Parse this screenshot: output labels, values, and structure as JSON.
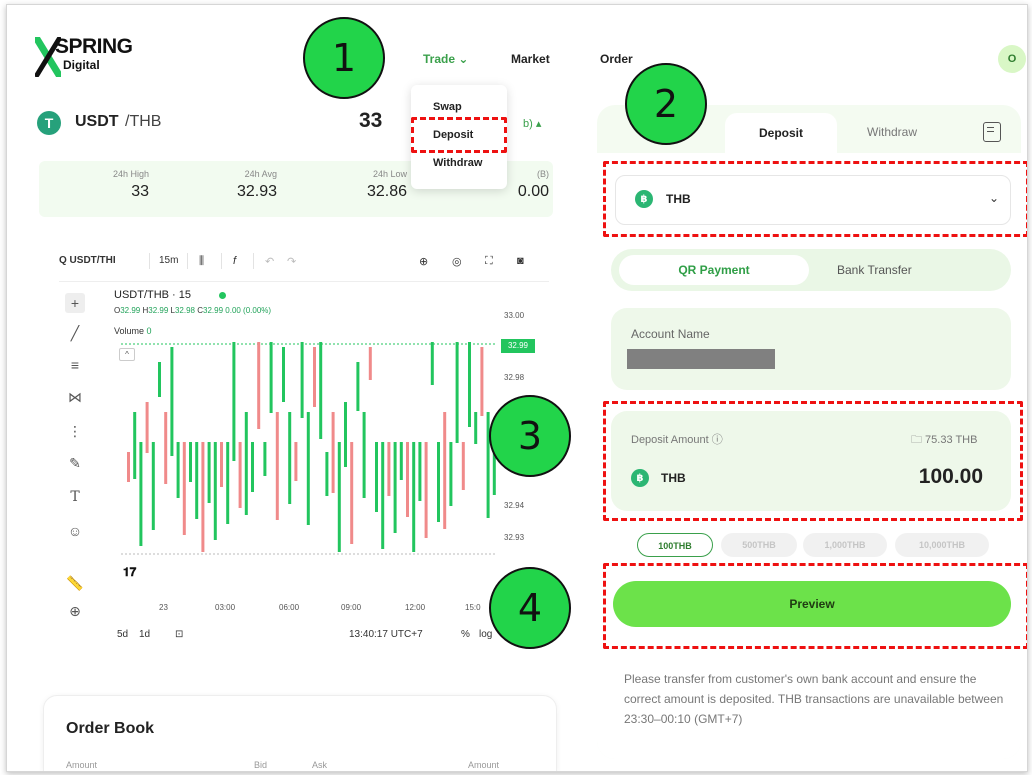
{
  "brand": {
    "name": "SPRING",
    "sub": "Digital"
  },
  "nav": {
    "trade": "Trade ⌄",
    "market": "Market",
    "order": "Order",
    "avatar": "O"
  },
  "trade_menu": {
    "swap": "Swap",
    "deposit": "Deposit",
    "withdraw": "Withdraw"
  },
  "pair": {
    "base": "USDT",
    "quote": "/THB",
    "price": "33",
    "price_tail": "b) ▴"
  },
  "stats": [
    {
      "label": "24h High",
      "value": "33"
    },
    {
      "label": "24h Avg",
      "value": "32.93"
    },
    {
      "label": "24h Low",
      "value": "32.86"
    },
    {
      "label": "(B)",
      "value": "0.00"
    }
  ],
  "chart_toolbar": {
    "symbol": "Q USDT/THI",
    "interval": "15m"
  },
  "chart_data": {
    "type": "candlestick",
    "title": "USDT/THB · 15",
    "ohlc_text": {
      "o": "32.99",
      "h": "32.99",
      "l": "32.98",
      "c": "32.99",
      "chg": "0.00 (0.00%)"
    },
    "volume_label": "Volume",
    "volume_value": "0",
    "y_ticks": [
      "33.00",
      "32.98",
      "32.94",
      "32.93"
    ],
    "last_price": "32.99",
    "x_ticks": [
      "23",
      "03:00",
      "06:00",
      "09:00",
      "12:00",
      "15:0"
    ],
    "ylim": [
      32.91,
      33.01
    ]
  },
  "chart_bottom": {
    "range_5d": "5d",
    "range_1d": "1d",
    "time": "13:40:17 UTC+7",
    "pct": "%",
    "log": "log"
  },
  "orderbook": {
    "title": "Order Book",
    "cols": [
      "Amount",
      "Bid",
      "Ask",
      "Amount"
    ]
  },
  "panel": {
    "tabs": {
      "deposit": "Deposit",
      "withdraw": "Withdraw"
    },
    "currency": "THB",
    "methods": {
      "qr": "QR Payment",
      "bank": "Bank Transfer"
    },
    "account_label": "Account Name",
    "amount_label": "Deposit Amount ⓘ",
    "balance": "🗀 75.33 THB",
    "amount_currency": "THB",
    "amount_value": "100.00",
    "quick_amounts": [
      "100THB",
      "500THB",
      "1,000THB",
      "10,000THB"
    ],
    "preview": "Preview",
    "note": "Please transfer from customer's own bank account and ensure the correct amount is deposited. THB transactions are unavailable between 23:30–00:10 (GMT+7)"
  },
  "callouts": [
    "1",
    "2",
    "3",
    "4"
  ],
  "colors": {
    "accent": "#6ce24a",
    "callout": "#22d44a",
    "highlight": "#e11111",
    "up": "#22c55e",
    "down": "#f08a8a"
  }
}
